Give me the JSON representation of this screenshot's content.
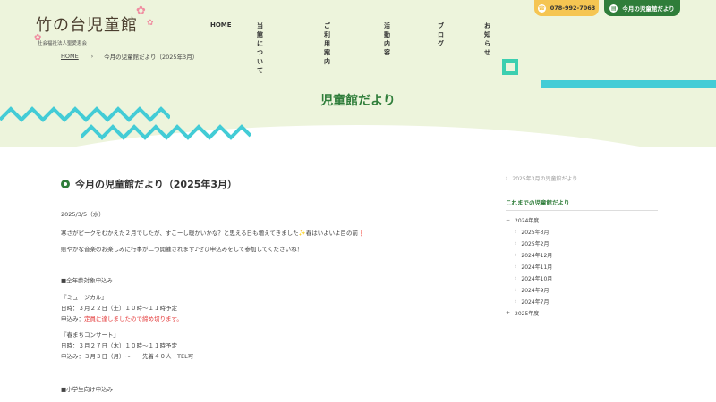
{
  "header": {
    "logo_title": "竹の台児童館",
    "logo_sub": "社会福祉法人聖愛恵会",
    "nav": [
      "HOME",
      "当館について",
      "ご利用案内",
      "活動内容",
      "ブログ",
      "お知らせ"
    ],
    "phone": "078-992-7063",
    "news_button": "今月の児童館だより",
    "icons": {
      "phone": "phone-icon",
      "news": "document-icon"
    }
  },
  "breadcrumb": {
    "home": "HOME",
    "current": "今月の児童館だより（2025年3月）"
  },
  "hero": {
    "title": "児童館だより"
  },
  "colors": {
    "brand_green": "#2f7d3a",
    "phone_yellow": "#f5c552",
    "accent_teal": "#43ccd6",
    "hero_bg": "#edf4dc",
    "alert_red": "#e43b3b"
  },
  "article": {
    "title": "今月の児童館だより（2025年3月）",
    "date": "2025/3/5（水）",
    "intro1": "寒さがピークをむかえた２月でしたが、すこーし暖かいかな？と思える日も増えてきました✨春はいよいよ目の前❗",
    "intro2": "賑やかな音楽のお楽しみに行事が二つ開催されます♪ぜひ申込みをして参加してくださいね！",
    "section1_heading": "■全年齢対象申込み",
    "event1_name": "『ミュージカル』",
    "event1_date": "日時：３月２２日（土）１０時～１１時予定",
    "event1_status_prefix": "申込み：",
    "event1_status": "定員に達しましたので締め切ります。",
    "event2_name": "『春まちコンサート』",
    "event2_date": "日時：３月２７日（木）１０時～１１時予定",
    "event2_apply": "申込み：３月３日（月）～　　先着４０人　TEL可",
    "section2_heading": "■小学生向け申込み"
  },
  "sidebar": {
    "latest": "2025年3月の児童館だより",
    "heading": "これまでの児童館だより",
    "year_2024": "2024年度",
    "months": [
      "2025年3月",
      "2025年2月",
      "2024年12月",
      "2024年11月",
      "2024年10月",
      "2024年9月",
      "2024年7月"
    ],
    "year_2025": "2025年度"
  }
}
